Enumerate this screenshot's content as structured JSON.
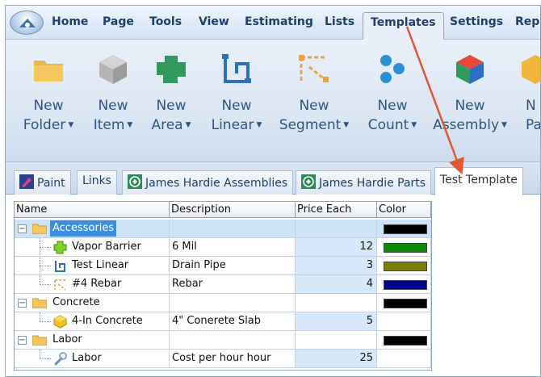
{
  "menu": {
    "tabs": [
      {
        "label": "Home"
      },
      {
        "label": "Page"
      },
      {
        "label": "Tools"
      },
      {
        "label": "View"
      },
      {
        "label": "Estimating"
      },
      {
        "label": "Lists"
      },
      {
        "label": "Templates"
      },
      {
        "label": "Settings"
      },
      {
        "label": "Repo"
      }
    ],
    "active": "Templates"
  },
  "ribbon": {
    "buttons": [
      {
        "line1": "New",
        "line2": "Folder",
        "icon": "folder-icon"
      },
      {
        "line1": "New",
        "line2": "Item",
        "icon": "cube-icon"
      },
      {
        "line1": "New",
        "line2": "Area",
        "icon": "area-icon"
      },
      {
        "line1": "New",
        "line2": "Linear",
        "icon": "linear-icon"
      },
      {
        "line1": "New",
        "line2": "Segment",
        "icon": "segment-icon"
      },
      {
        "line1": "New",
        "line2": "Count",
        "icon": "count-icon"
      },
      {
        "line1": "New",
        "line2": "Assembly",
        "icon": "assembly-icon"
      },
      {
        "line1": "N",
        "line2": "Pa",
        "icon": "package-icon"
      }
    ],
    "arrow": "▼"
  },
  "doc_tabs": [
    {
      "label": "Paint"
    },
    {
      "label": "Links"
    },
    {
      "label": "James Hardie Assemblies"
    },
    {
      "label": "James Hardie Parts"
    },
    {
      "label": "Test Template"
    }
  ],
  "grid": {
    "columns": [
      "Name",
      "Description",
      "Price Each",
      "Color"
    ],
    "rows": [
      {
        "name": "Accessories",
        "desc": "",
        "price": "",
        "type": "folder",
        "color": "#000000"
      },
      {
        "name": "Vapor Barrier",
        "desc": "6 Mil",
        "price": "12",
        "type": "area",
        "color": "#0a8a0a"
      },
      {
        "name": "Test Linear",
        "desc": "Drain Pipe",
        "price": "3",
        "type": "linear",
        "color": "#7d7d00"
      },
      {
        "name": "#4 Rebar",
        "desc": "Rebar",
        "price": "4",
        "type": "segment",
        "color": "#00008b"
      },
      {
        "name": "Concrete",
        "desc": "",
        "price": "",
        "type": "folder",
        "color": "#000000"
      },
      {
        "name": "4-In Concrete",
        "desc": "4\" Conerete Slab",
        "price": "5",
        "type": "item",
        "color": ""
      },
      {
        "name": "Labor",
        "desc": "",
        "price": "",
        "type": "folder",
        "color": "#000000"
      },
      {
        "name": "Labor",
        "desc": "Cost per hour hour",
        "price": "25",
        "type": "labor",
        "color": ""
      }
    ]
  },
  "expander": {
    "collapse": "−"
  }
}
